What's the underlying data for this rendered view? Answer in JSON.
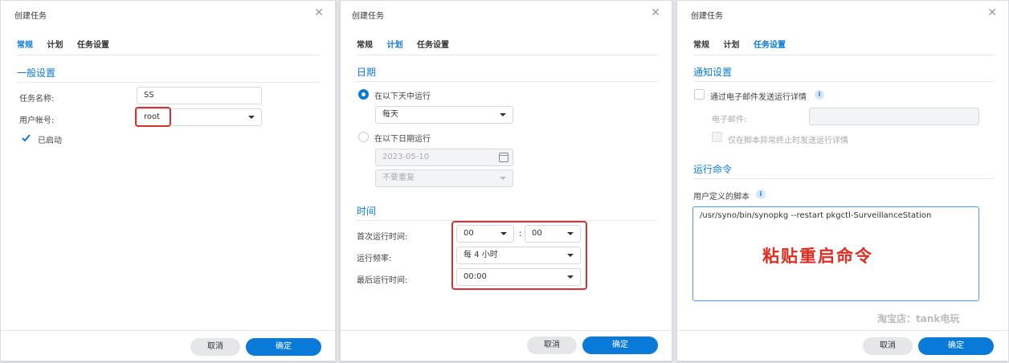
{
  "dialog1": {
    "title": "创建任务",
    "tabs": [
      "常规",
      "计划",
      "任务设置"
    ],
    "section_general": "一般设置",
    "task_name_label": "任务名称:",
    "task_name_value": "SS",
    "user_label": "用户帐号:",
    "user_value": "root",
    "enabled_label": "已启动",
    "cancel": "取消",
    "ok": "确定"
  },
  "dialog2": {
    "title": "创建任务",
    "tabs": [
      "常规",
      "计划",
      "任务设置"
    ],
    "section_date": "日期",
    "radio_days": "在以下天中运行",
    "days_value": "每天",
    "radio_date": "在以下日期运行",
    "date_value": "2023-05-10",
    "repeat_value": "不要重复",
    "section_time": "时间",
    "first_run_label": "首次运行时间:",
    "first_hour": "00",
    "first_minute": "00",
    "colon": ":",
    "frequency_label": "运行频率:",
    "frequency_value": "每 4 小时",
    "last_run_label": "最后运行时间:",
    "last_run_value": "00:00",
    "cancel": "取消",
    "ok": "确定"
  },
  "dialog3": {
    "title": "创建任务",
    "tabs": [
      "常规",
      "计划",
      "任务设置"
    ],
    "section_notify": "通知设置",
    "email_details_label": "通过电子邮件发送运行详情",
    "email_label": "电子邮件:",
    "email_value": "",
    "abnormal_only_label": "仅在脚本异常终止时发送运行详情",
    "section_command": "运行命令",
    "script_label": "用户定义的脚本",
    "script_value": "/usr/syno/bin/synopkg --restart pkgctl-SurveillanceStation",
    "overlay_text": "粘贴重启命令",
    "watermark": "淘宝店：tank电玩",
    "cancel": "取消",
    "ok": "确定"
  },
  "icons": {
    "close": "close-icon",
    "dropdown": "chevron-down-icon",
    "info": "info-icon",
    "calendar": "calendar-icon",
    "check": "checkmark-icon"
  },
  "colors": {
    "accent": "#0a7ad9",
    "highlight": "#d9302c"
  }
}
